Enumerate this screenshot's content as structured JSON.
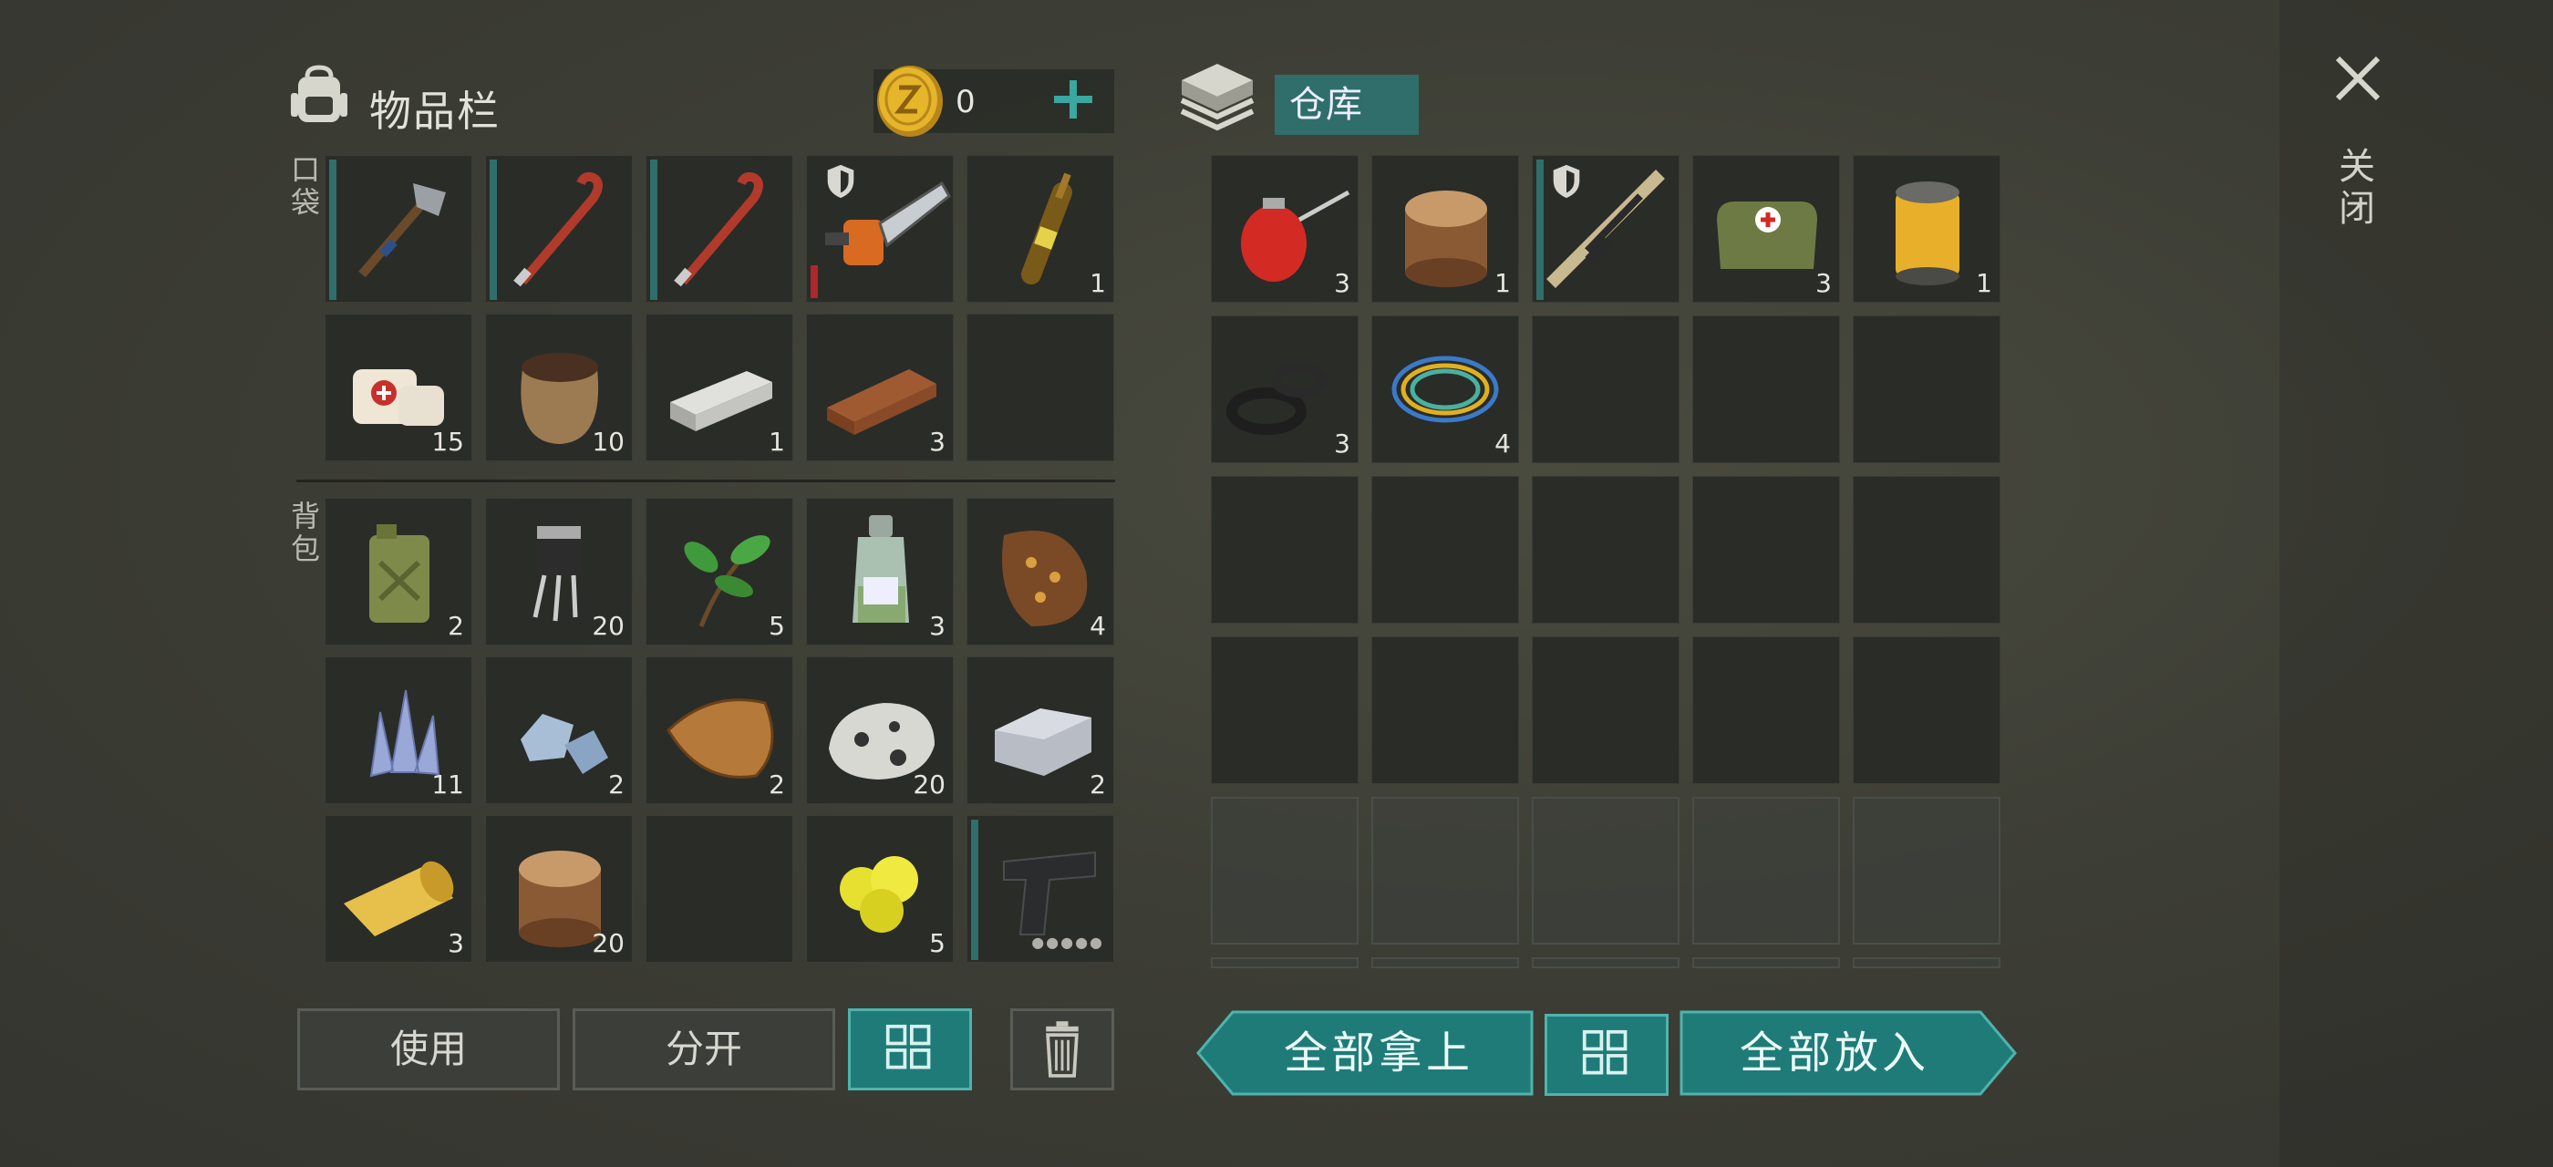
{
  "inventory": {
    "title": "物品栏",
    "coins": "0"
  },
  "storage": {
    "title": "仓库"
  },
  "close": {
    "label": "关闭"
  },
  "sections": {
    "pocket": "口袋",
    "backpack": "背包"
  },
  "inventory_slots": [
    {
      "name": "hatchet-icon",
      "qty": "",
      "dura": "teal"
    },
    {
      "name": "crowbar-icon",
      "qty": "",
      "dura": "teal"
    },
    {
      "name": "crowbar-icon",
      "qty": "",
      "dura": "teal"
    },
    {
      "name": "chainsaw-icon",
      "qty": "",
      "dura": "red",
      "badge": true
    },
    {
      "name": "ampoule-icon",
      "qty": "1"
    },
    {
      "name": "bandage-icon",
      "qty": "15"
    },
    {
      "name": "fertilizer-sack-icon",
      "qty": "10"
    },
    {
      "name": "iron-ingot-icon",
      "qty": "1"
    },
    {
      "name": "plank-icon",
      "qty": "3"
    },
    {
      "name": "empty",
      "qty": ""
    },
    {
      "name": "jerrycan-icon",
      "qty": "2"
    },
    {
      "name": "transistor-icon",
      "qty": "20"
    },
    {
      "name": "herb-leaves-icon",
      "qty": "5"
    },
    {
      "name": "chemical-bottle-icon",
      "qty": "3"
    },
    {
      "name": "spiked-hide-icon",
      "qty": "4"
    },
    {
      "name": "crystal-icon",
      "qty": "11"
    },
    {
      "name": "aluminum-ore-icon",
      "qty": "2"
    },
    {
      "name": "reptile-skin-icon",
      "qty": "2"
    },
    {
      "name": "ore-rock-icon",
      "qty": "20"
    },
    {
      "name": "aluminum-ingot-icon",
      "qty": "2"
    },
    {
      "name": "fabric-roll-icon",
      "qty": "3"
    },
    {
      "name": "log-icon",
      "qty": "20"
    },
    {
      "name": "empty",
      "qty": ""
    },
    {
      "name": "sulfur-icon",
      "qty": "5"
    },
    {
      "name": "pistol-icon",
      "qty": "",
      "dura": "teal",
      "dots": "●●●●●"
    }
  ],
  "storage_slots": [
    {
      "name": "oil-can-icon",
      "qty": "3"
    },
    {
      "name": "log-icon",
      "qty": "1"
    },
    {
      "name": "rifle-icon",
      "qty": "",
      "dura": "teal",
      "badge": true
    },
    {
      "name": "medkit-bag-icon",
      "qty": "3"
    },
    {
      "name": "oil-filter-icon",
      "qty": "1"
    },
    {
      "name": "rubber-seals-icon",
      "qty": "3"
    },
    {
      "name": "wires-icon",
      "qty": "4"
    }
  ],
  "buttons": {
    "use": "使用",
    "split": "分开",
    "take_all": "全部拿上",
    "put_all": "全部放入"
  },
  "colors": {
    "accent": "#1f7b78",
    "durability_teal": "#2f6e6a",
    "durability_red": "#b0262a",
    "coin": "#e5b52a"
  }
}
